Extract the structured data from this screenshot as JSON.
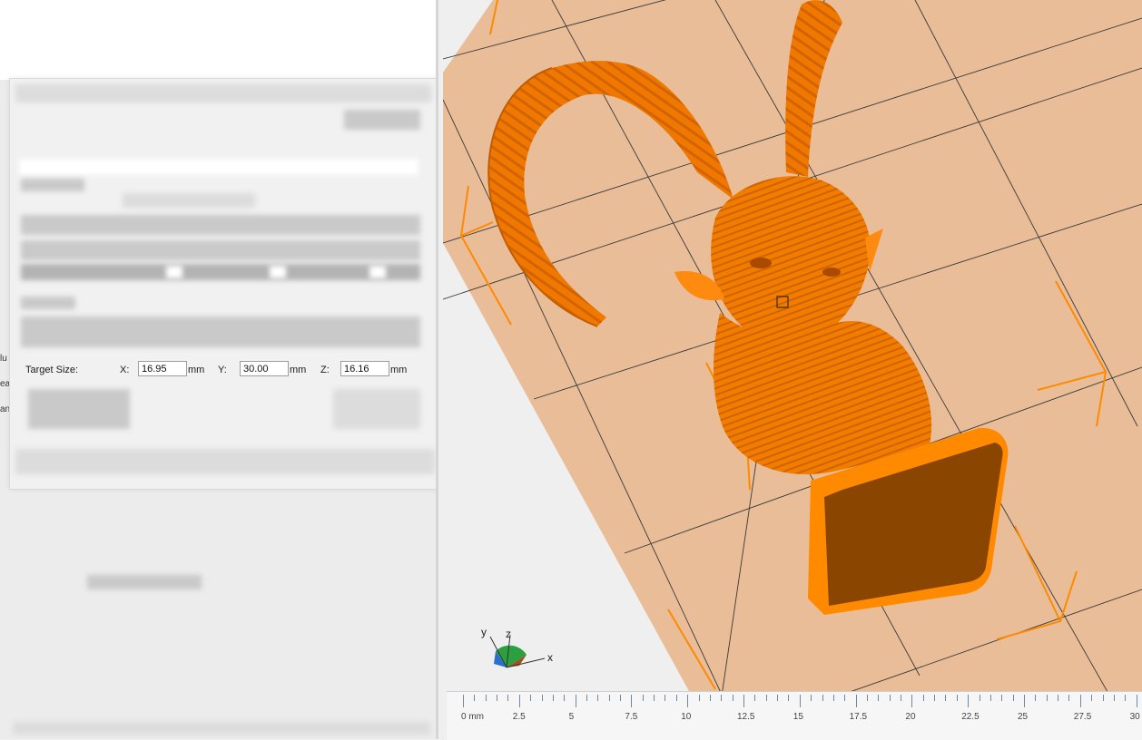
{
  "scale_dialog": {
    "target_size_label": "Target Size:",
    "x_label": "X:",
    "x_value": "16.95",
    "y_label": "Y:",
    "y_value": "30.00",
    "z_label": "Z:",
    "z_value": "16.16",
    "unit": "mm"
  },
  "left_edge_fragments": [
    "lu",
    "ea",
    "an"
  ],
  "viewport": {
    "model_color": "#ff8000",
    "bed_color": "#e8bd98",
    "axis_labels": {
      "x": "x",
      "y": "y",
      "z": "z"
    }
  },
  "ruler": {
    "labels": [
      "0 mm",
      "2.5",
      "5",
      "7.5",
      "10",
      "12.5",
      "15",
      "17.5",
      "20",
      "22.5",
      "25",
      "27.5",
      "30"
    ]
  }
}
